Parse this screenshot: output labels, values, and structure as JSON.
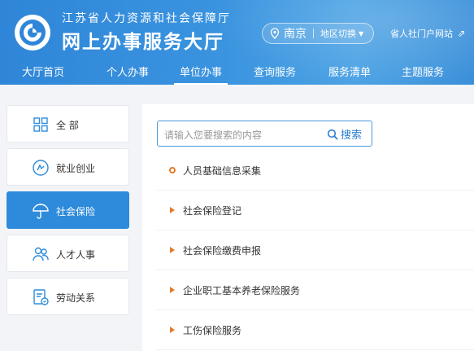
{
  "header": {
    "subtitle": "江苏省人力资源和社会保障厅",
    "title": "网上办事服务大厅",
    "city": "南京",
    "region_switch": "地区切换",
    "portal_link": "省人社门户网站"
  },
  "nav": {
    "items": [
      {
        "label": "大厅首页"
      },
      {
        "label": "个人办事"
      },
      {
        "label": "单位办事"
      },
      {
        "label": "查询服务"
      },
      {
        "label": "服务清单"
      },
      {
        "label": "主题服务"
      }
    ],
    "active": "单位办事"
  },
  "sidebar": {
    "items": [
      {
        "label": "全  部",
        "icon": "grid-icon"
      },
      {
        "label": "就业创业",
        "icon": "employment-icon"
      },
      {
        "label": "社会保险",
        "icon": "umbrella-icon"
      },
      {
        "label": "人才人事",
        "icon": "people-icon"
      },
      {
        "label": "劳动关系",
        "icon": "document-icon"
      }
    ],
    "active": "社会保险"
  },
  "search": {
    "placeholder": "请输入您要搜索的内容",
    "button_label": "搜索"
  },
  "services": {
    "items": [
      {
        "label": "人员基础信息采集",
        "bullet": "circle"
      },
      {
        "label": "社会保险登记",
        "bullet": "triangle"
      },
      {
        "label": "社会保险缴费申报",
        "bullet": "triangle"
      },
      {
        "label": "企业职工基本养老保险服务",
        "bullet": "triangle"
      },
      {
        "label": "工伤保险服务",
        "bullet": "triangle"
      }
    ]
  },
  "colors": {
    "header_blue": "#2f86d8",
    "active_blue": "#2e8bdb",
    "bullet_orange": "#e8782a"
  }
}
